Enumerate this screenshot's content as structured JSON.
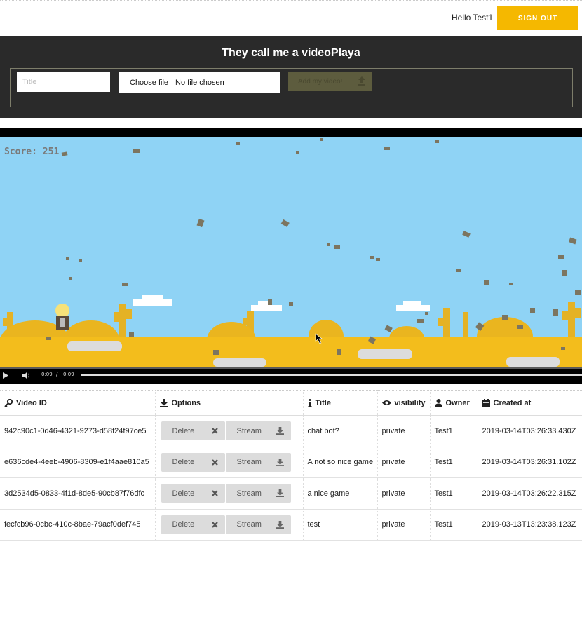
{
  "topbar": {
    "greeting": "Hello Test1",
    "signout_label": "SIGN OUT"
  },
  "header": {
    "brand": "They call me a videoPlaya",
    "title_placeholder": "Title",
    "file_choose_label": "Choose file",
    "file_status": "No file chosen",
    "add_button_label": "Add my video!"
  },
  "player": {
    "score_text": "Score: 251",
    "current_time": "0:09",
    "time_separator": "/",
    "duration": "0:09"
  },
  "table": {
    "headers": {
      "video_id": "Video ID",
      "options": "Options",
      "title": "Title",
      "visibility": "visibility",
      "owner": "Owner",
      "created_at": "Created at"
    },
    "delete_label": "Delete",
    "stream_label": "Stream",
    "rows": [
      {
        "id": "942c90c1-0d46-4321-9273-d58f24f97ce5",
        "title": "chat bot?",
        "visibility": "private",
        "owner": "Test1",
        "created": "2019-03-14T03:26:33.430Z"
      },
      {
        "id": "e636cde4-4eeb-4906-8309-e1f4aae810a5",
        "title": "A not so nice game",
        "visibility": "private",
        "owner": "Test1",
        "created": "2019-03-14T03:26:31.102Z"
      },
      {
        "id": "3d2534d5-0833-4f1d-8de5-90cb87f76dfc",
        "title": "a nice game",
        "visibility": "private",
        "owner": "Test1",
        "created": "2019-03-14T03:26:22.315Z"
      },
      {
        "id": "fecfcb96-0cbc-410c-8bae-79acf0def745",
        "title": "test",
        "visibility": "private",
        "owner": "Test1",
        "created": "2019-03-13T13:23:38.123Z"
      }
    ]
  },
  "colors": {
    "accent": "#f5b800",
    "header_bg": "#2a2a2a",
    "sky": "#8fd3f5",
    "sand": "#f3bd1c"
  }
}
